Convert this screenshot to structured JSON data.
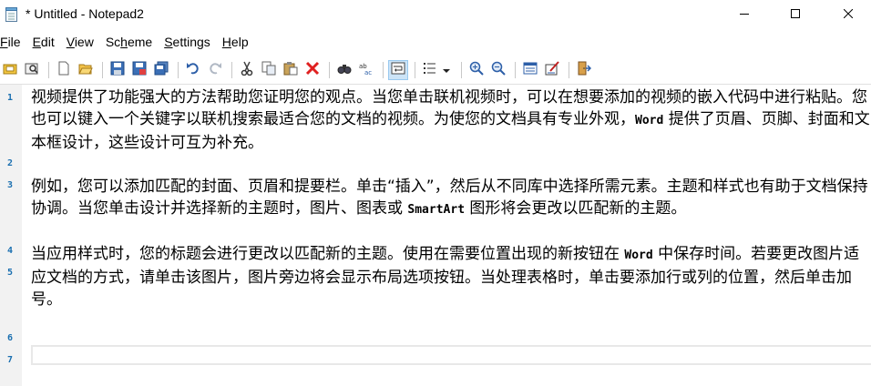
{
  "window": {
    "title": "* Untitled - Notepad2",
    "icons": {
      "app": "notepad-icon",
      "minimize": "minimize-icon",
      "maximize": "maximize-icon",
      "close": "close-icon"
    }
  },
  "menu": [
    {
      "label": "File",
      "acc": "F",
      "rest": "ile"
    },
    {
      "label": "Edit",
      "acc": "E",
      "rest": "dit"
    },
    {
      "label": "View",
      "acc": "V",
      "rest": "iew"
    },
    {
      "label": "Scheme",
      "pre": "Sc",
      "acc": "h",
      "rest": "eme"
    },
    {
      "label": "Settings",
      "acc": "S",
      "rest": "ettings"
    },
    {
      "label": "Help",
      "acc": "H",
      "rest": "elp"
    }
  ],
  "toolbar": {
    "icons": [
      "run-icon",
      "open-folder-icon",
      "new-icon",
      "open-icon",
      "save-icon",
      "save-as-icon",
      "save-copy-icon",
      "undo-icon",
      "redo-icon",
      "cut-icon",
      "copy-icon",
      "paste-icon",
      "delete-icon",
      "find-icon",
      "replace-icon",
      "word-wrap-icon",
      "bookmark-list-icon",
      "dropdown-icon",
      "zoom-in-icon",
      "zoom-out-icon",
      "scheme-icon",
      "customize-icon",
      "exit-icon"
    ],
    "colors": {
      "active_bg": "#cce4f7",
      "active_border": "#99c9ef"
    }
  },
  "editor": {
    "line_numbers": [
      "1",
      "2",
      "3",
      "4",
      "5",
      "6",
      "7"
    ],
    "line_number_color": "#1a6fb0",
    "p1_a": "视频提供了功能强大的方法帮助您证明您的观点。当您单击联机视频时，可以在想要添加的视频的嵌入代码中进行粘贴。您也可以键入一个关键字以联机搜索最适合您的文档的视频。为使您的文档具有专业外观，",
    "p1_word": "Word",
    "p1_b": " 提供了页眉、页脚、封面和文本框设计，这些设计可互为补充。",
    "p3_a": "例如，您可以添加匹配的封面、页眉和提要栏。单击“插入”，然后从不同库中选择所需元素。主题和样式也有助于文档保持协调。当您单击设计并选择新的主题时，图片、图表或 ",
    "p3_smartart": "SmartArt",
    "p3_b": " 图形将会更改以匹配新的主题。",
    "p5_a": "当应用样式时，您的标题会进行更改以匹配新的主题。使用在需要位置出现的新按钮在 ",
    "p5_word": "Word",
    "p5_b": " 中保存时间。若要更改图片适应文档的方式，请单击该图片，图片旁边将会显示布局选项按钮。当处理表格时，单击要添加行或列的位置，然后单击加号。"
  }
}
